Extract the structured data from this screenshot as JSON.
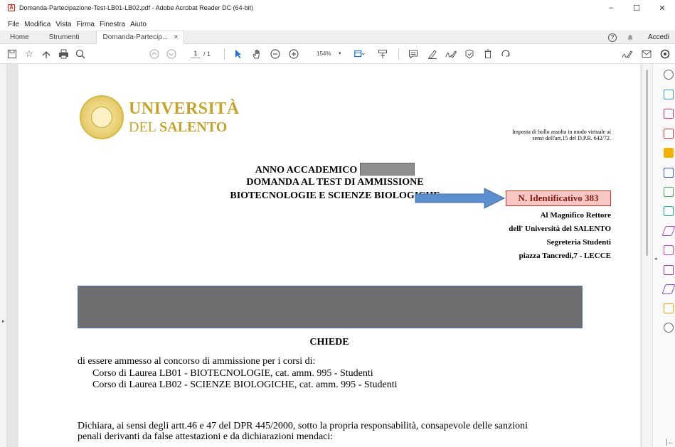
{
  "window": {
    "title": "Domanda-Partecipazione-Test-LB01-LB02.pdf - Adobe Acrobat Reader DC (64-bit)",
    "minimize": "–",
    "maximize": "☐",
    "close": "✕"
  },
  "menu": [
    "File",
    "Modifica",
    "Vista",
    "Firma",
    "Finestra",
    "Aiuto"
  ],
  "tabs": {
    "home": "Home",
    "tools": "Strumenti",
    "document": "Domanda-Partecip...",
    "document_close": "×"
  },
  "tabrow_right": {
    "help": "?",
    "signin": "Accedi"
  },
  "toolbar": {
    "page_current": "1",
    "page_total": "/ 1",
    "zoom": "154%"
  },
  "document": {
    "logo_line1": "UNIVERSITÀ",
    "logo_line2_a": "DEL ",
    "logo_line2_b": "SALENTO",
    "bollo_line1": "Imposta di bollo assolta in modo virtuale ai",
    "bollo_line2": "sensi dell'art.15 del D.P.R. 642/72.",
    "heading1": "ANNO ACCADEMICO",
    "heading2": "DOMANDA AL TEST DI AMMISSIONE",
    "heading3": "BIOTECNOLOGIE E SCIENZE BIOLOGICHE",
    "id_label": "N. Identificativo 383",
    "addr1": "Al Magnifico Rettore",
    "addr2": "dell' Università del SALENTO",
    "addr3": "Segreteria Studenti",
    "addr4": "piazza Tancredi,7 - LECCE",
    "chiede": "CHIEDE",
    "intro": "di essere ammesso al concorso di ammissione per i corsi di:",
    "course1": "Corso di Laurea LB01 - BIOTECNOLOGIE, cat. amm. 995 - Studenti",
    "course2": "Corso di Laurea LB02 - SCIENZE BIOLOGICHE, cat. amm. 995 - Studenti",
    "declaration1": "Dichiara, ai sensi degli artt.46 e 47 del DPR 445/2000, sotto la propria responsabilità, consapevole delle sanzioni",
    "declaration2": "penali derivanti da false attestazioni e da dichiarazioni mendaci:"
  },
  "colors": {
    "id_box_fill": "#f6c7c3",
    "id_box_border": "#c63a32",
    "arrow": "#4f86c6",
    "logo_gold": "#c7a427",
    "redaction": "#6f6f6f"
  },
  "icons": {
    "toolbar": [
      "save-icon",
      "bookmark-star-icon",
      "share-icon",
      "print-icon",
      "zoom-search-icon",
      "page-up-icon",
      "page-down-icon",
      "select-arrow-icon",
      "hand-icon",
      "zoom-out-icon",
      "zoom-in-icon",
      "fit-page-icon",
      "scroll-mode-icon",
      "comment-icon",
      "highlight-pen-icon",
      "sign-icon",
      "stamp-icon",
      "delete-icon",
      "rotate-icon",
      "fill-sign-icon",
      "email-icon",
      "account-icon"
    ],
    "right_panel": [
      "export-pdf-icon",
      "create-pdf-icon",
      "organize-pages-icon",
      "edit-pdf-icon",
      "comment-tool-icon",
      "combine-files-icon",
      "compress-icon",
      "protect-icon",
      "fill-sign-tool-icon",
      "send-review-icon",
      "forms-icon",
      "sign-tool-icon",
      "stamp-tool-icon",
      "more-tools-icon"
    ]
  }
}
